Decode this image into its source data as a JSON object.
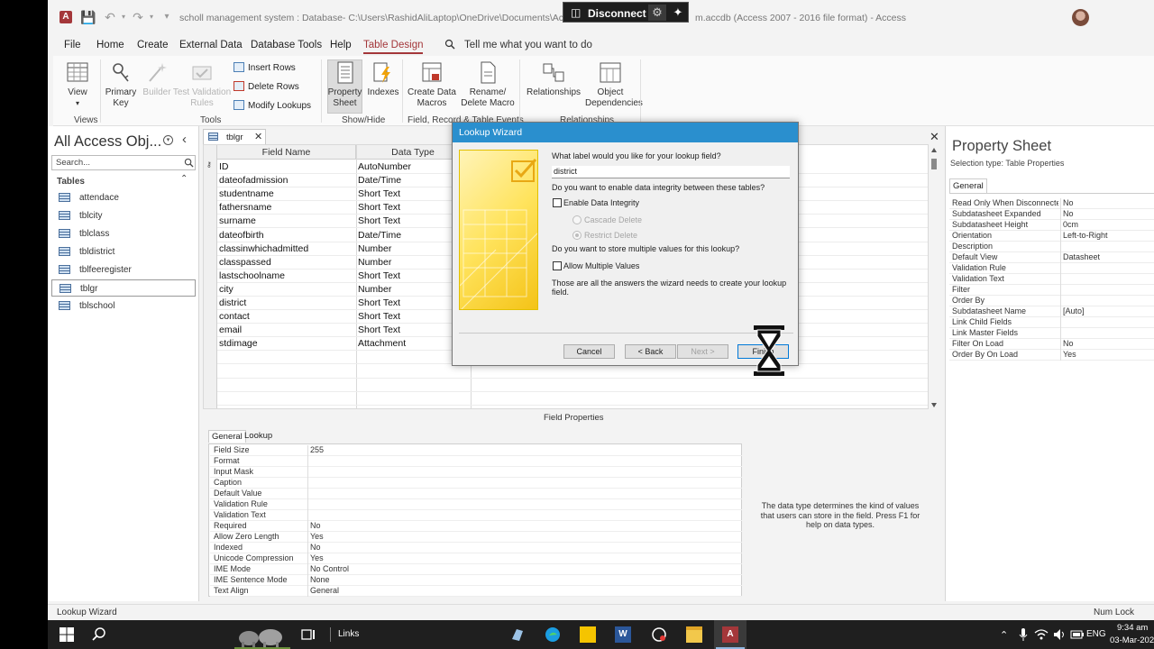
{
  "window": {
    "title_left": "scholl management system : Database- C:\\Users\\RashidAliLaptop\\OneDrive\\Documents\\Access File",
    "title_right": "m.accdb (Access 2007 - 2016 file format) - Access",
    "remote_label": "Disconnect"
  },
  "menu": {
    "items": [
      "File",
      "Home",
      "Create",
      "External Data",
      "Database Tools",
      "Help",
      "Table Design"
    ],
    "active": "Table Design",
    "tell_me": "Tell me what you want to do"
  },
  "ribbon": {
    "view": "View",
    "primary_key": "Primary Key",
    "builder": "Builder",
    "test_validation": "Test Validation Rules",
    "insert_rows": "Insert Rows",
    "delete_rows": "Delete Rows",
    "modify_lookups": "Modify Lookups",
    "property_sheet": "Property Sheet",
    "indexes": "Indexes",
    "create_data_macros": "Create Data Macros",
    "rename_delete_macro": "Rename/ Delete Macro",
    "relationships": "Relationships",
    "object_dependencies": "Object Dependencies",
    "groups": {
      "views": "Views",
      "tools": "Tools",
      "show_hide": "Show/Hide",
      "field_record": "Field, Record & Table Events",
      "relationships": "Relationships"
    }
  },
  "nav": {
    "title": "All Access Obj...",
    "search_placeholder": "Search...",
    "section": "Tables",
    "items": [
      "attendace",
      "tblcity",
      "tblclass",
      "tbldistrict",
      "tblfeeregister",
      "tblgr",
      "tblschool"
    ],
    "selected": "tblgr"
  },
  "doc": {
    "tab": "tblgr",
    "columns": [
      "Field Name",
      "Data Type"
    ],
    "fields": [
      {
        "name": "ID",
        "type": "AutoNumber"
      },
      {
        "name": "dateofadmission",
        "type": "Date/Time"
      },
      {
        "name": "studentname",
        "type": "Short Text"
      },
      {
        "name": "fathersname",
        "type": "Short Text"
      },
      {
        "name": "surname",
        "type": "Short Text"
      },
      {
        "name": "dateofbirth",
        "type": "Date/Time"
      },
      {
        "name": "classinwhichadmitted",
        "type": "Number"
      },
      {
        "name": "classpassed",
        "type": "Number"
      },
      {
        "name": "lastschoolname",
        "type": "Short Text"
      },
      {
        "name": "city",
        "type": "Number"
      },
      {
        "name": "district",
        "type": "Short Text"
      },
      {
        "name": "contact",
        "type": "Short Text"
      },
      {
        "name": "email",
        "type": "Short Text"
      },
      {
        "name": "stdimage",
        "type": "Attachment"
      }
    ],
    "field_properties_title": "Field Properties",
    "prop_tabs": [
      "General",
      "Lookup"
    ],
    "props": [
      {
        "name": "Field Size",
        "value": "255"
      },
      {
        "name": "Format",
        "value": ""
      },
      {
        "name": "Input Mask",
        "value": ""
      },
      {
        "name": "Caption",
        "value": ""
      },
      {
        "name": "Default Value",
        "value": ""
      },
      {
        "name": "Validation Rule",
        "value": ""
      },
      {
        "name": "Validation Text",
        "value": ""
      },
      {
        "name": "Required",
        "value": "No"
      },
      {
        "name": "Allow Zero Length",
        "value": "Yes"
      },
      {
        "name": "Indexed",
        "value": "No"
      },
      {
        "name": "Unicode Compression",
        "value": "Yes"
      },
      {
        "name": "IME Mode",
        "value": "No Control"
      },
      {
        "name": "IME Sentence Mode",
        "value": "None"
      },
      {
        "name": "Text Align",
        "value": "General"
      }
    ],
    "help_text": "The data type determines the kind of values that users can store in the field. Press F1 for help on data types."
  },
  "property_sheet": {
    "title": "Property Sheet",
    "selection_type": "Selection type:  Table Properties",
    "tab": "General",
    "rows": [
      {
        "name": "Read Only When Disconnected",
        "value": "No"
      },
      {
        "name": "Subdatasheet Expanded",
        "value": "No"
      },
      {
        "name": "Subdatasheet Height",
        "value": "0cm"
      },
      {
        "name": "Orientation",
        "value": "Left-to-Right"
      },
      {
        "name": "Description",
        "value": ""
      },
      {
        "name": "Default View",
        "value": "Datasheet"
      },
      {
        "name": "Validation Rule",
        "value": ""
      },
      {
        "name": "Validation Text",
        "value": ""
      },
      {
        "name": "Filter",
        "value": ""
      },
      {
        "name": "Order By",
        "value": ""
      },
      {
        "name": "Subdatasheet Name",
        "value": "[Auto]"
      },
      {
        "name": "Link Child Fields",
        "value": ""
      },
      {
        "name": "Link Master Fields",
        "value": ""
      },
      {
        "name": "Filter On Load",
        "value": "No"
      },
      {
        "name": "Order By On Load",
        "value": "Yes"
      }
    ]
  },
  "wizard": {
    "title": "Lookup Wizard",
    "q_label": "What label would you like for your lookup field?",
    "label_value": "district",
    "q_integrity": "Do you want to enable data integrity between these tables?",
    "enable_integrity": "Enable Data Integrity",
    "cascade_delete": "Cascade Delete",
    "restrict_delete": "Restrict Delete",
    "q_multiple": "Do you want to store multiple values for this lookup?",
    "allow_multiple": "Allow Multiple Values",
    "info": "Those are all the answers the wizard needs to create your lookup field.",
    "cancel": "Cancel",
    "back": "< Back",
    "next": "Next >",
    "finish": "Finish"
  },
  "status": {
    "left": "Lookup Wizard",
    "right": "Num Lock"
  },
  "taskbar": {
    "links": "Links",
    "lang": "ENG",
    "time": "9:34 am",
    "date": "03-Mar-202"
  },
  "colors": {
    "access_accent": "#a4373a",
    "wizard_title_bar": "#2a8fce",
    "taskbar": "#1f1f1f"
  }
}
